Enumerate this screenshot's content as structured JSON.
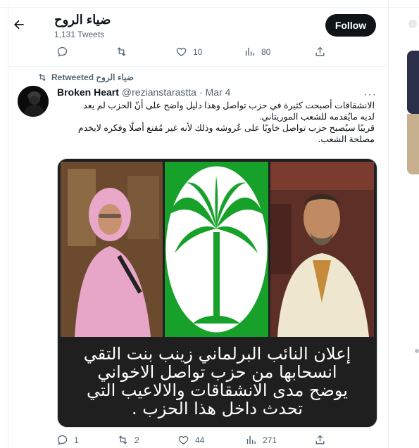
{
  "profile": {
    "name": "ضياء الروح",
    "tweets_count": "1,131 Tweets",
    "follow_label": "Follow"
  },
  "top_actions": {
    "replies": "",
    "retweets": "",
    "likes": "10",
    "views": "80"
  },
  "tweet": {
    "retweeted_by": "ضياء الروح Retweeted",
    "author_name": "Broken Heart",
    "author_handle": "@rezianstarastta",
    "separator": "·",
    "date": "Mar 4",
    "text_lines": [
      "الانشقاقات أصبحت كثيرة في حزب تواصل وهذا دليل واضح على أنّ الحزب لم يعد",
      "لديه مايُقدمه للشعب الموريتاني.",
      "قريبًا سيُصبح حزب تواصل خاويًا على عُروشه وذلك لأنه غير مُقنع أصلًا وفكره لايخدم",
      "مصلحة الشعب."
    ],
    "image_caption_lines": [
      "إعلان النائب البرلماني زينب بنت التقي",
      "انسحابها من حزب تواصل الاخواني",
      "يوضح مدى الانشقاقات والالاعيب التي",
      "تحدث داخل هذا الحزب ."
    ],
    "replies": "1",
    "retweets": "2",
    "likes": "44",
    "views": "271"
  },
  "icons": [
    "back-arrow-icon",
    "reply-icon",
    "retweet-icon",
    "like-icon",
    "views-icon",
    "share-icon",
    "more-icon"
  ],
  "colors": {
    "follow_bg": "#0f1419",
    "text_secondary": "#536471",
    "border": "#eff3f4",
    "logo_green": "#17a12a"
  }
}
